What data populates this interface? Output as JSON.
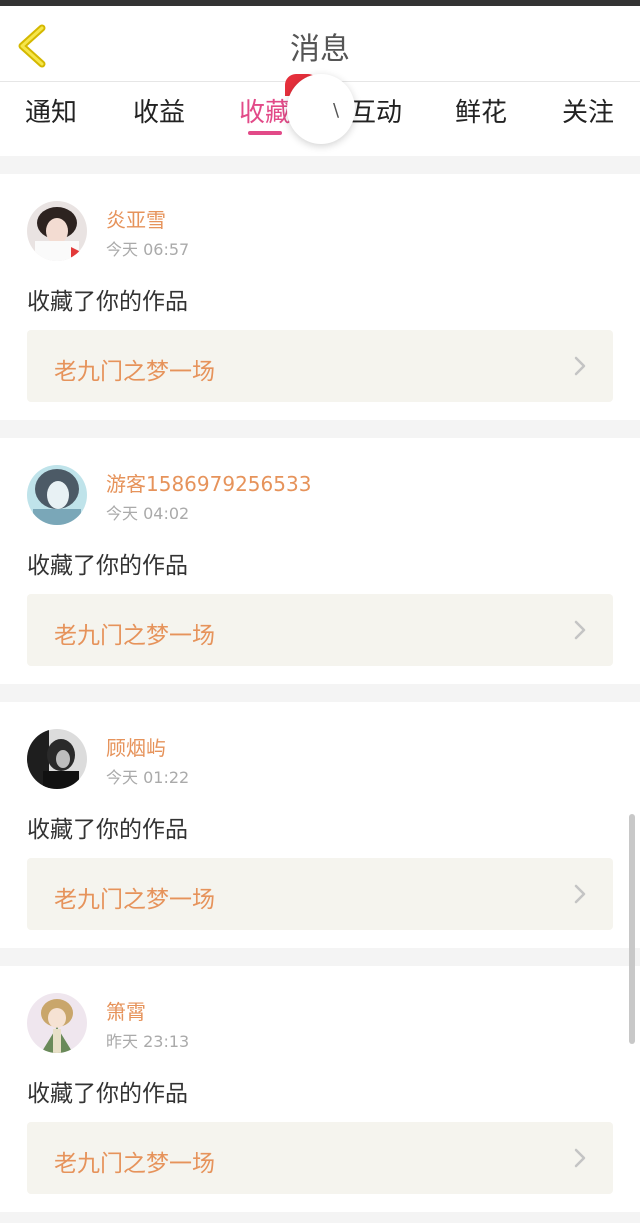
{
  "header": {
    "title": "消息"
  },
  "tabs": [
    {
      "label": "通知"
    },
    {
      "label": "收益"
    },
    {
      "label": "收藏"
    },
    {
      "label": "互动"
    },
    {
      "label": "鲜花"
    },
    {
      "label": "关注"
    }
  ],
  "active_tab": "收藏",
  "colors": {
    "accent": "#e24a88",
    "name": "#e6935b",
    "badge": "#e52f3b"
  },
  "items": [
    {
      "user": "炎亚雪",
      "time": "今天 06:57",
      "action": "收藏了你的作品",
      "work": "老九门之梦一场",
      "avatar_icon": "girl-avatar"
    },
    {
      "user": "游客1586979256533",
      "time": "今天 04:02",
      "action": "收藏了你的作品",
      "work": "老九门之梦一场",
      "avatar_icon": "girl-avatar"
    },
    {
      "user": "顾烟屿",
      "time": "今天 01:22",
      "action": "收藏了你的作品",
      "work": "老九门之梦一场",
      "avatar_icon": "bw-photo-avatar"
    },
    {
      "user": "箫霄",
      "time": "昨天 23:13",
      "action": "收藏了你的作品",
      "work": "老九门之梦一场",
      "avatar_icon": "anime-avatar"
    }
  ]
}
